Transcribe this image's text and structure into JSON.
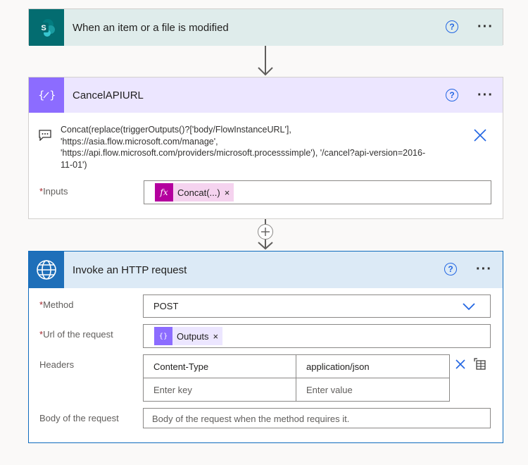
{
  "trigger": {
    "title": "When an item or a file is modified",
    "icon": "sharepoint-icon",
    "help": "?",
    "more": "···"
  },
  "compose": {
    "title": "CancelAPIURL",
    "icon": "compose-icon",
    "help": "?",
    "more": "···",
    "expression_lines": [
      "Concat(replace(triggerOutputs()?['body/FlowInstanceURL'],",
      "'https://asia.flow.microsoft.com/manage',",
      "'https://api.flow.microsoft.com/providers/microsoft.processsimple'), '/cancel?api-version=2016-",
      "11-01')"
    ],
    "inputs_label": "Inputs",
    "required_mark": "*",
    "inputs_token": {
      "icon_text": "fx",
      "label": "Concat(...)",
      "remove": "×",
      "color": "#b4009e",
      "bg": "#f5d3ef"
    }
  },
  "http": {
    "title": "Invoke an HTTP request",
    "icon": "globe-icon",
    "help": "?",
    "more": "···",
    "method_label": "Method",
    "method_value": "POST",
    "url_label": "Url of the request",
    "url_token": {
      "icon_text": "{}",
      "label": "Outputs",
      "remove": "×",
      "color": "#8c6cff",
      "bg": "#ece6ff"
    },
    "headers_label": "Headers",
    "headers": [
      {
        "key": "Content-Type",
        "value": "application/json"
      }
    ],
    "header_key_placeholder": "Enter key",
    "header_value_placeholder": "Enter value",
    "body_label": "Body of the request",
    "body_placeholder": "Body of the request when the method requires it.",
    "required_mark": "*"
  },
  "colors": {
    "accent": "#2266e3",
    "sharepoint": "#036c70",
    "compose": "#8c6cff",
    "http": "#1e6fb9"
  }
}
